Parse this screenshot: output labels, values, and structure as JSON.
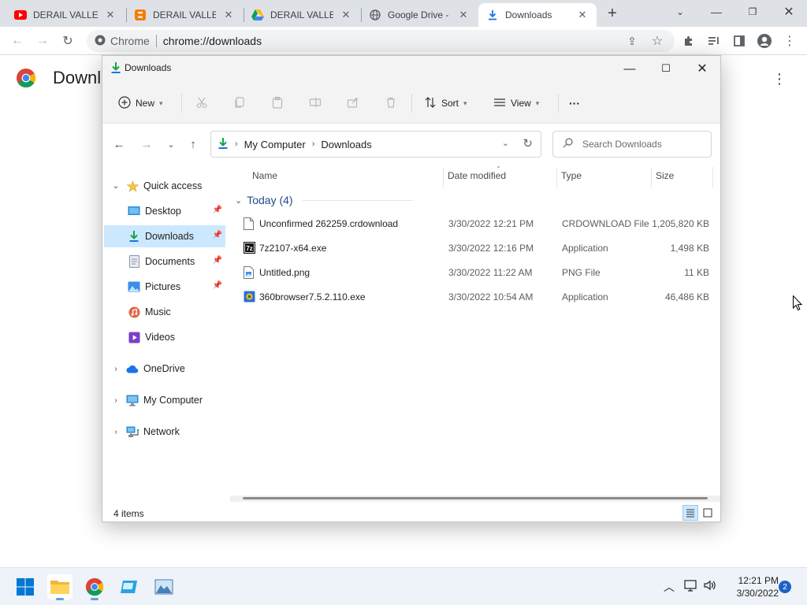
{
  "browser": {
    "tabs": [
      {
        "title": "DERAIL VALLEY",
        "favicon": "youtube-icon"
      },
      {
        "title": "DERAIL VALLEY",
        "favicon": "blogger-icon"
      },
      {
        "title": "DERAIL VALLEY",
        "favicon": "google-drive-icon"
      },
      {
        "title": "Google Drive - D",
        "favicon": "globe-icon"
      },
      {
        "title": "Downloads",
        "favicon": "download-icon",
        "active": true
      }
    ],
    "omnibox": {
      "scheme_label": "Chrome",
      "url": "chrome://downloads"
    },
    "page_title": "Downloads"
  },
  "explorer": {
    "title": "Downloads",
    "commands": {
      "new": "New",
      "sort": "Sort",
      "view": "View",
      "more": "···"
    },
    "breadcrumb": [
      "My Computer",
      "Downloads"
    ],
    "search_placeholder": "Search Downloads",
    "sidebar": [
      {
        "label": "Quick access",
        "icon": "star-icon",
        "expanded": true
      },
      {
        "label": "Desktop",
        "icon": "desktop-icon",
        "pinned": true
      },
      {
        "label": "Downloads",
        "icon": "download-icon",
        "pinned": true,
        "selected": true
      },
      {
        "label": "Documents",
        "icon": "documents-icon",
        "pinned": true
      },
      {
        "label": "Pictures",
        "icon": "pictures-icon",
        "pinned": true
      },
      {
        "label": "Music",
        "icon": "music-icon"
      },
      {
        "label": "Videos",
        "icon": "videos-icon"
      },
      {
        "label": "OneDrive",
        "icon": "cloud-icon",
        "expanded": false
      },
      {
        "label": "My Computer",
        "icon": "computer-icon",
        "expanded": false
      },
      {
        "label": "Network",
        "icon": "network-icon",
        "expanded": false
      }
    ],
    "columns": [
      "Name",
      "Date modified",
      "Type",
      "Size"
    ],
    "group": "Today (4)",
    "files": [
      {
        "name": "Unconfirmed 262259.crdownload",
        "date": "3/30/2022 12:21 PM",
        "type": "CRDOWNLOAD File",
        "size": "1,205,820 KB",
        "icon": "blank-file-icon"
      },
      {
        "name": "7z2107-x64.exe",
        "date": "3/30/2022 12:16 PM",
        "type": "Application",
        "size": "1,498 KB",
        "icon": "7zip-icon"
      },
      {
        "name": "Untitled.png",
        "date": "3/30/2022 11:22 AM",
        "type": "PNG File",
        "size": "11 KB",
        "icon": "image-file-icon"
      },
      {
        "name": "360browser7.5.2.110.exe",
        "date": "3/30/2022 10:54 AM",
        "type": "Application",
        "size": "46,486 KB",
        "icon": "app-file-icon"
      }
    ],
    "status": "4 items"
  },
  "taskbar": {
    "clock_time": "12:21 PM",
    "clock_date": "3/30/2022",
    "notifications": "2"
  },
  "colors": {
    "accent": "#0067c0",
    "selection": "#cce8ff",
    "group_header": "#1e4a8c"
  }
}
